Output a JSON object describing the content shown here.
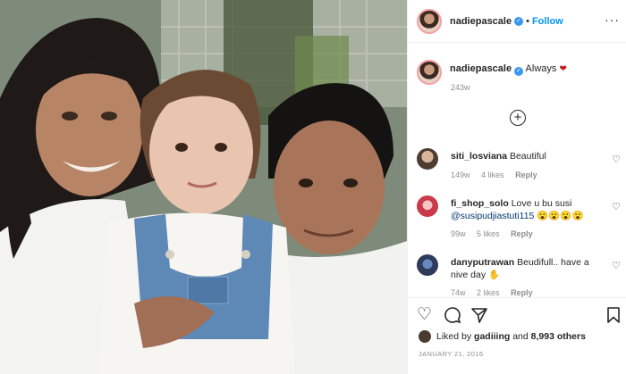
{
  "post": {
    "author": "nadiepascale",
    "follow_label": "Follow",
    "caption_text": "Always",
    "caption_time": "243w",
    "date": "JANUARY 21, 2016"
  },
  "comments": [
    {
      "user": "siti_losviana",
      "text": "Beautiful",
      "time": "149w",
      "likes": "4 likes",
      "reply": "Reply"
    },
    {
      "user": "fi_shop_solo",
      "text": "Love u bu susi",
      "mention": "@susipudjiastuti115",
      "emoji": "😮😮😮😮",
      "time": "99w",
      "likes": "5 likes",
      "reply": "Reply"
    },
    {
      "user": "danyputrawan",
      "text": "Beudifull.. have a nive day",
      "time": "74w",
      "likes": "2 likes",
      "reply": "Reply"
    }
  ],
  "likes": {
    "text_prefix": "Liked by",
    "user": "gadiiing",
    "text_and": "and",
    "count": "8,993 others"
  },
  "icons": {
    "more": "more-options-icon",
    "load_more": "plus-circle-icon",
    "like": "heart-outline-icon",
    "comment": "comment-bubble-icon",
    "share": "paper-plane-icon",
    "save": "bookmark-icon"
  },
  "colors": {
    "accent": "#0095f6",
    "verified": "#3897f0",
    "heart": "#c01820"
  }
}
